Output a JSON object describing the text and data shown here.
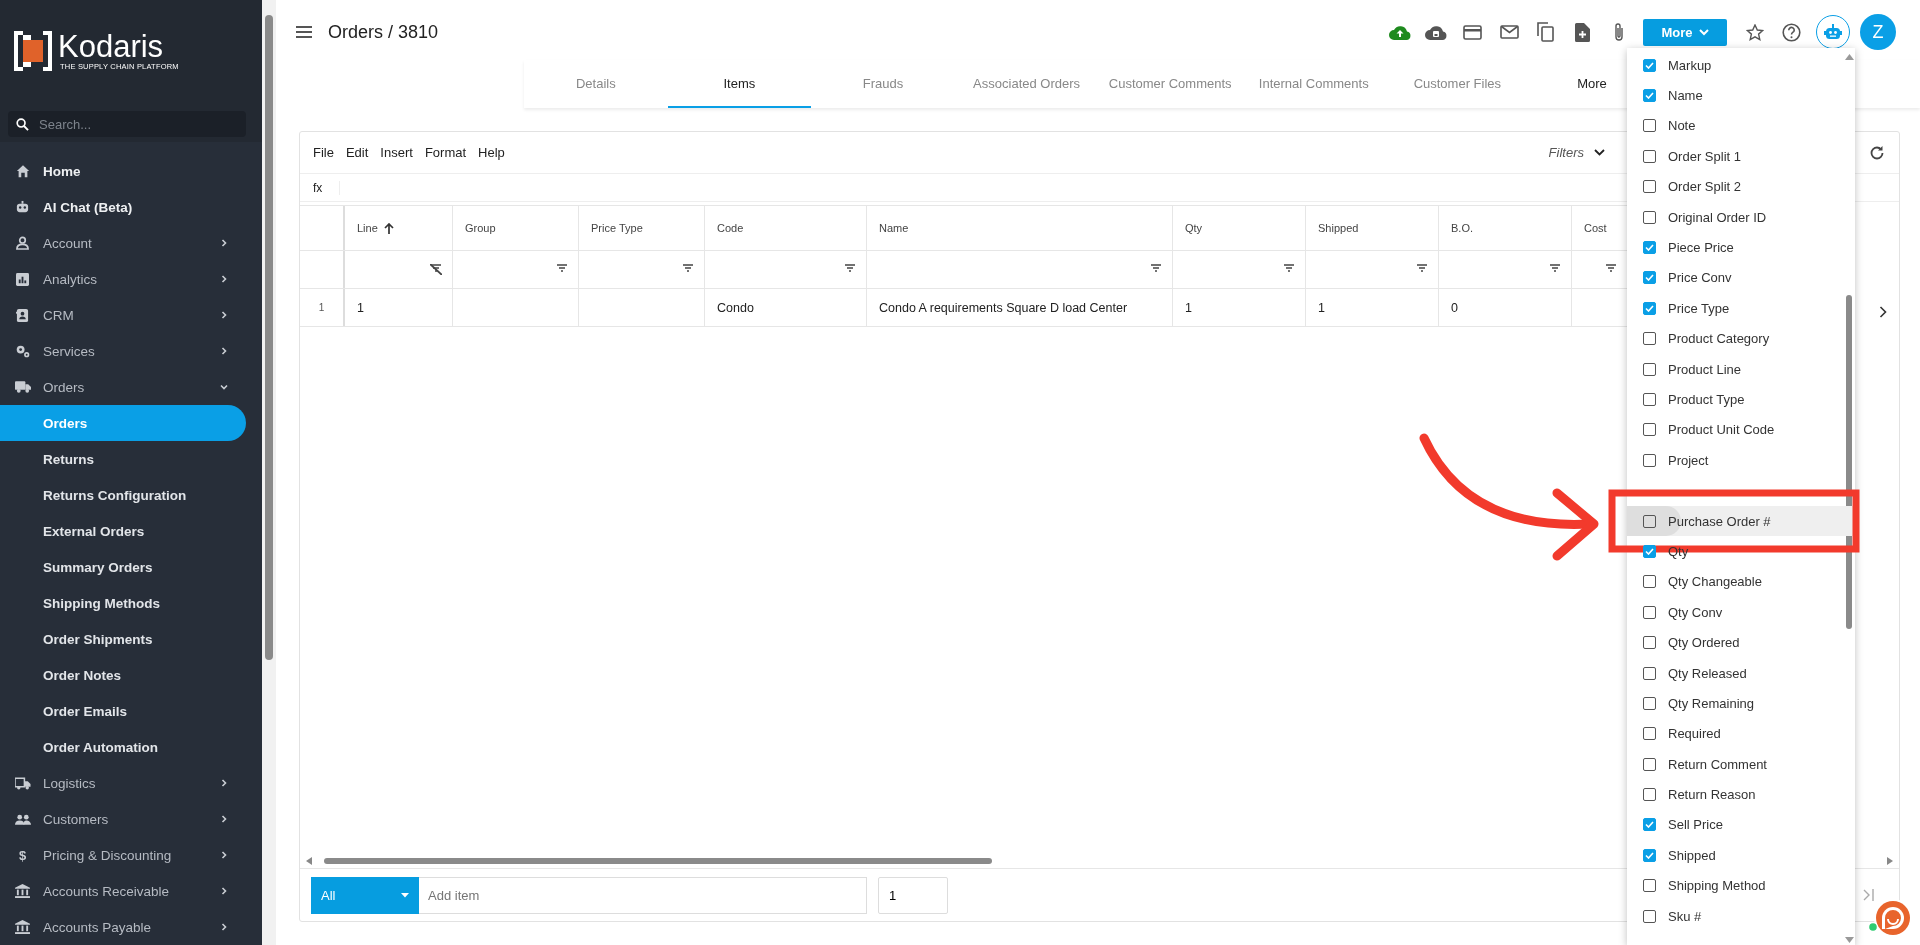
{
  "sidebar": {
    "brand": "Kodaris",
    "tagline": "THE SUPPLY CHAIN PLATFORM",
    "search": {
      "placeholder": "Search..."
    },
    "items": [
      {
        "label": "Home",
        "kind": "link",
        "selected": false
      },
      {
        "label": "AI Chat (Beta)",
        "kind": "link",
        "selected": false
      },
      {
        "label": "Account",
        "kind": "group",
        "expanded": false,
        "selected": false
      },
      {
        "label": "Analytics",
        "kind": "group",
        "expanded": false,
        "selected": false
      },
      {
        "label": "CRM",
        "kind": "group",
        "expanded": false,
        "selected": false
      },
      {
        "label": "Services",
        "kind": "group",
        "expanded": false,
        "selected": false
      },
      {
        "label": "Orders",
        "kind": "group",
        "expanded": true,
        "selected": false,
        "children": [
          {
            "label": "Orders",
            "selected": true
          },
          {
            "label": "Returns",
            "selected": false
          },
          {
            "label": "Returns Configuration",
            "selected": false
          },
          {
            "label": "External Orders",
            "selected": false
          },
          {
            "label": "Summary Orders",
            "selected": false
          },
          {
            "label": "Shipping Methods",
            "selected": false
          },
          {
            "label": "Order Shipments",
            "selected": false
          },
          {
            "label": "Order Notes",
            "selected": false
          },
          {
            "label": "Order Emails",
            "selected": false
          },
          {
            "label": "Order Automation",
            "selected": false
          }
        ]
      },
      {
        "label": "Logistics",
        "kind": "group",
        "expanded": false,
        "selected": false
      },
      {
        "label": "Customers",
        "kind": "group",
        "expanded": false,
        "selected": false
      },
      {
        "label": "Pricing & Discounting",
        "kind": "group",
        "expanded": false,
        "selected": false,
        "icon_text": "$"
      },
      {
        "label": "Accounts Receivable",
        "kind": "group",
        "expanded": false,
        "selected": false
      },
      {
        "label": "Accounts Payable",
        "kind": "group",
        "expanded": false,
        "selected": false
      }
    ]
  },
  "header": {
    "title": "Orders / 3810",
    "more_button": "More",
    "avatar": "Z"
  },
  "tabs": [
    {
      "label": "Details",
      "kind": "tab",
      "selected": false
    },
    {
      "label": "Items",
      "kind": "tab",
      "selected": true
    },
    {
      "label": "Frauds",
      "kind": "tab",
      "selected": false
    },
    {
      "label": "Associated Orders",
      "kind": "tab",
      "selected": false
    },
    {
      "label": "Customer Comments",
      "kind": "tab",
      "selected": false
    },
    {
      "label": "Internal Comments",
      "kind": "tab",
      "selected": false
    },
    {
      "label": "Customer Files",
      "kind": "tab",
      "selected": false
    },
    {
      "label": "More",
      "kind": "menu",
      "selected": false
    }
  ],
  "grid": {
    "menu": [
      "File",
      "Edit",
      "Insert",
      "Format",
      "Help"
    ],
    "filters": "Filters",
    "formula_label": "fx",
    "columns": [
      {
        "label": "Line",
        "sorted_ascending": true,
        "filter_cleared": true
      },
      {
        "label": "Group",
        "sorted_ascending": false,
        "filter_cleared": false
      },
      {
        "label": "Price Type",
        "sorted_ascending": false,
        "filter_cleared": false
      },
      {
        "label": "Code",
        "sorted_ascending": false,
        "filter_cleared": false
      },
      {
        "label": "Name",
        "sorted_ascending": false,
        "filter_cleared": false
      },
      {
        "label": "Qty",
        "sorted_ascending": false,
        "filter_cleared": false
      },
      {
        "label": "Shipped",
        "sorted_ascending": false,
        "filter_cleared": false
      },
      {
        "label": "B.O.",
        "sorted_ascending": false,
        "filter_cleared": false
      },
      {
        "label": "Cost",
        "sorted_ascending": false,
        "filter_cleared": false
      }
    ],
    "rows": [
      {
        "row_number": "1",
        "cells": [
          "1",
          null,
          null,
          "Condo",
          "Condo A requirements Square D load Center",
          "1",
          "1",
          "0",
          null
        ]
      }
    ]
  },
  "footer": {
    "scope": "All",
    "add_placeholder": "Add item",
    "quantity": "1"
  },
  "column_menu": {
    "items": [
      {
        "label": "Markup",
        "checked": true,
        "highlighted": false
      },
      {
        "label": "Name",
        "checked": true,
        "highlighted": false
      },
      {
        "label": "Note",
        "checked": false,
        "highlighted": false
      },
      {
        "label": "Order Split 1",
        "checked": false,
        "highlighted": false
      },
      {
        "label": "Order Split 2",
        "checked": false,
        "highlighted": false
      },
      {
        "label": "Original Order ID",
        "checked": false,
        "highlighted": false
      },
      {
        "label": "Piece Price",
        "checked": true,
        "highlighted": false
      },
      {
        "label": "Price Conv",
        "checked": true,
        "highlighted": false
      },
      {
        "label": "Price Type",
        "checked": true,
        "highlighted": false
      },
      {
        "label": "Product Category",
        "checked": false,
        "highlighted": false
      },
      {
        "label": "Product Line",
        "checked": false,
        "highlighted": false
      },
      {
        "label": "Product Type",
        "checked": false,
        "highlighted": false
      },
      {
        "label": "Product Unit Code",
        "checked": false,
        "highlighted": false
      },
      {
        "label": "Project",
        "checked": false,
        "highlighted": false
      },
      {
        "label": "Purchase Order #",
        "checked": false,
        "highlighted": true
      },
      {
        "label": "Qty",
        "checked": true,
        "highlighted": false
      },
      {
        "label": "Qty Changeable",
        "checked": false,
        "highlighted": false
      },
      {
        "label": "Qty Conv",
        "checked": false,
        "highlighted": false
      },
      {
        "label": "Qty Ordered",
        "checked": false,
        "highlighted": false
      },
      {
        "label": "Qty Released",
        "checked": false,
        "highlighted": false
      },
      {
        "label": "Qty Remaining",
        "checked": false,
        "highlighted": false
      },
      {
        "label": "Required",
        "checked": false,
        "highlighted": false
      },
      {
        "label": "Return Comment",
        "checked": false,
        "highlighted": false
      },
      {
        "label": "Return Reason",
        "checked": false,
        "highlighted": false
      },
      {
        "label": "Sell Price",
        "checked": true,
        "highlighted": false
      },
      {
        "label": "Shipped",
        "checked": true,
        "highlighted": false
      },
      {
        "label": "Shipping Method",
        "checked": false,
        "highlighted": false
      },
      {
        "label": "Sku #",
        "checked": false,
        "highlighted": false
      }
    ]
  }
}
